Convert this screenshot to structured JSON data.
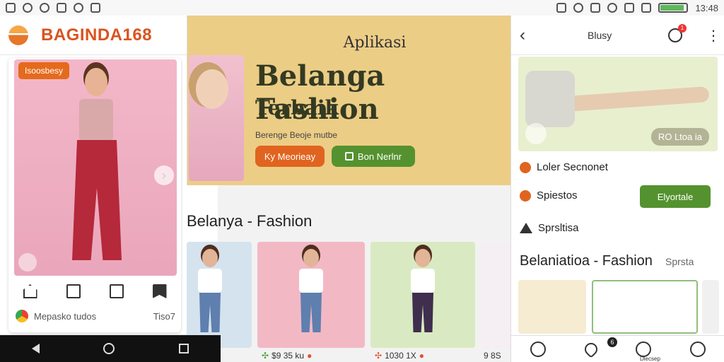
{
  "status_bar": {
    "time": "13:48",
    "battery_level": 0.9
  },
  "left_app": {
    "brand": "BAGINDA168",
    "product": {
      "badge": "Isoosbesy",
      "footer_text": "Mepasko tudos",
      "footer_value": "Tiso7"
    }
  },
  "banner": {
    "subtitle": "Aplikasi",
    "title": "Belanga Fashion",
    "title2": "Terbaik",
    "tagline": "Berenge Beoje mutbe",
    "btn_orange": "Ky Meorieay",
    "btn_green": "Bon Nerlnr"
  },
  "section": {
    "title": "Belanya - Fashion",
    "prices": [
      "$9 35 ku",
      "1030 1X",
      "9 8S"
    ]
  },
  "right_app": {
    "header_title": "Blusy",
    "bell_badge": "1",
    "hero_label": "RO Ltoa ia",
    "row1": "Loler Secnonet",
    "row2": "Spiestos",
    "row2_button": "Elyortale",
    "row3": "Sprsltisa",
    "section_title": "Belaniatioa - Fashion",
    "section_link": "Sprsta",
    "nav_badge": "6",
    "nav_label": "Dlecsep"
  }
}
